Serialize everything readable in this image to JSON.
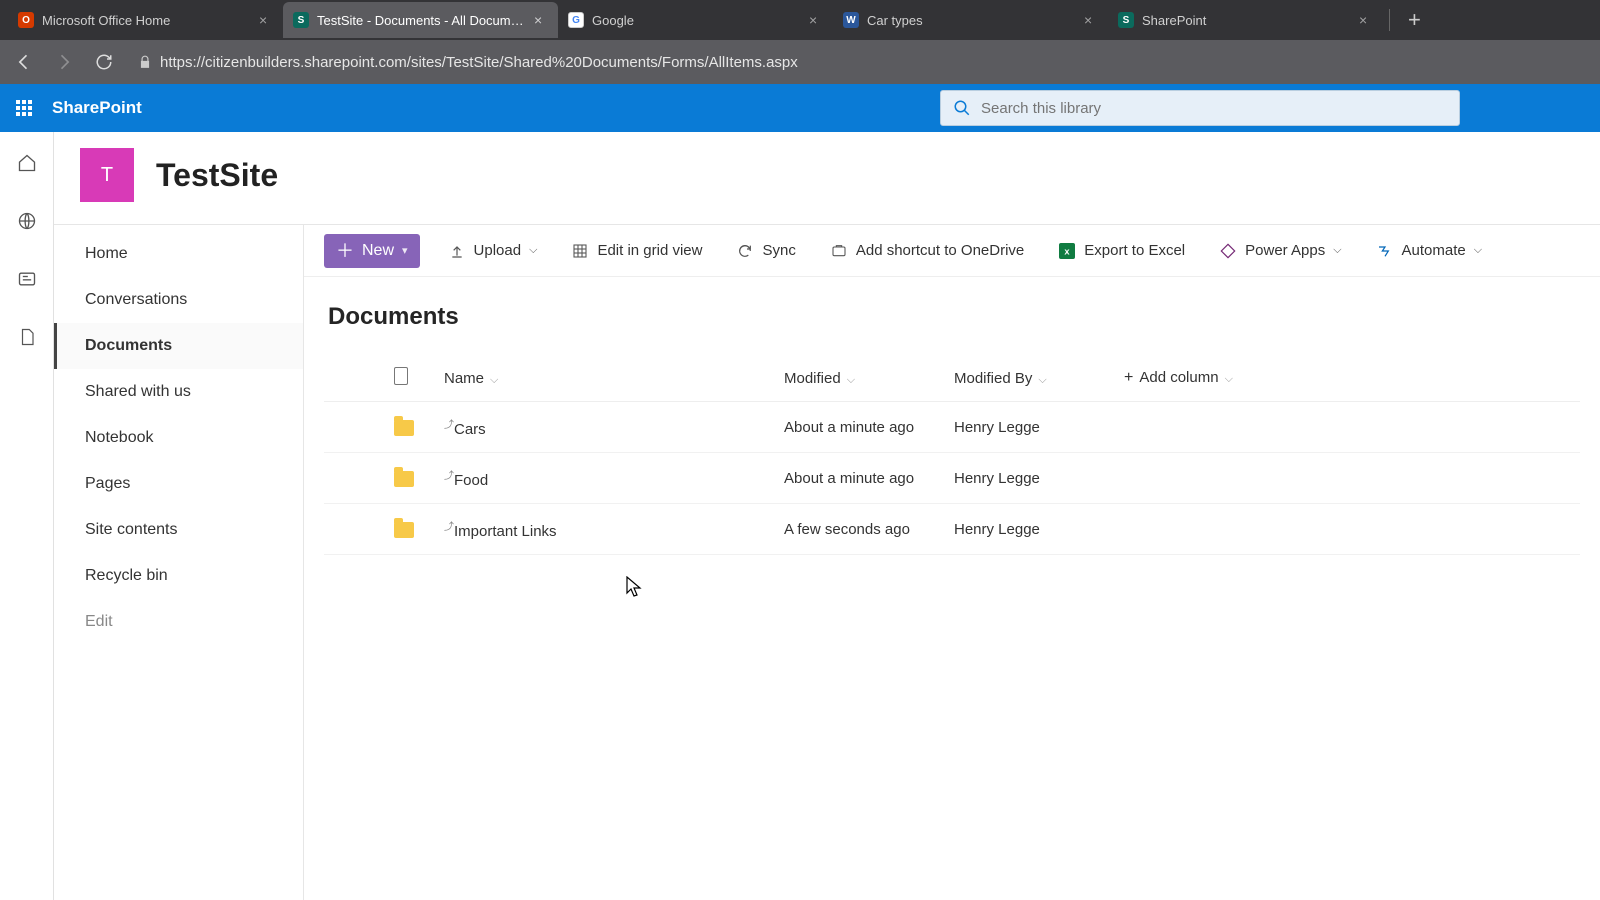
{
  "browser": {
    "tabs": [
      {
        "title": "Microsoft Office Home",
        "favcolor": "#d53a00",
        "favtext": "O"
      },
      {
        "title": "TestSite - Documents - All Documents",
        "favcolor": "#0b6a5d",
        "favtext": "S",
        "active": true
      },
      {
        "title": "Google",
        "favcolor": "#ffffff",
        "favtext": "G"
      },
      {
        "title": "Car types",
        "favcolor": "#2b579a",
        "favtext": "W"
      },
      {
        "title": "SharePoint",
        "favcolor": "#0b6a5d",
        "favtext": "S"
      }
    ],
    "url": "https://citizenbuilders.sharepoint.com/sites/TestSite/Shared%20Documents/Forms/AllItems.aspx"
  },
  "suite": {
    "name": "SharePoint",
    "search_placeholder": "Search this library"
  },
  "site": {
    "logo_letter": "T",
    "title": "TestSite"
  },
  "leftnav": {
    "items": [
      {
        "label": "Home"
      },
      {
        "label": "Conversations"
      },
      {
        "label": "Documents",
        "selected": true
      },
      {
        "label": "Shared with us"
      },
      {
        "label": "Notebook"
      },
      {
        "label": "Pages"
      },
      {
        "label": "Site contents"
      },
      {
        "label": "Recycle bin"
      },
      {
        "label": "Edit",
        "muted": true
      }
    ]
  },
  "commandbar": {
    "new": "New",
    "upload": "Upload",
    "edit_grid": "Edit in grid view",
    "sync": "Sync",
    "shortcut": "Add shortcut to OneDrive",
    "export": "Export to Excel",
    "powerapps": "Power Apps",
    "automate": "Automate"
  },
  "library": {
    "title": "Documents",
    "columns": {
      "name": "Name",
      "modified": "Modified",
      "modified_by": "Modified By",
      "add": "Add column"
    },
    "rows": [
      {
        "name": "Cars",
        "modified": "About a minute ago",
        "modified_by": "Henry Legge"
      },
      {
        "name": "Food",
        "modified": "About a minute ago",
        "modified_by": "Henry Legge"
      },
      {
        "name": "Important Links",
        "modified": "A few seconds ago",
        "modified_by": "Henry Legge"
      }
    ]
  }
}
